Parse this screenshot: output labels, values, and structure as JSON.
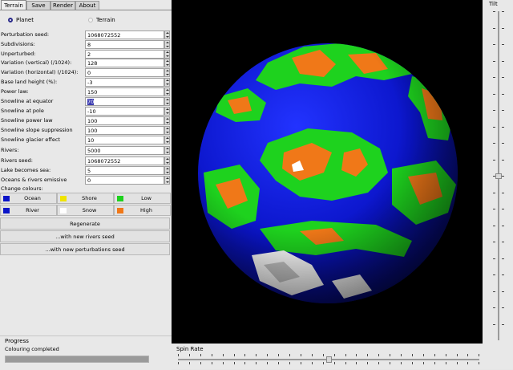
{
  "tabs": [
    "Terrain",
    "Save",
    "Render",
    "About"
  ],
  "active_tab": "Terrain",
  "mode": {
    "options": [
      "Planet",
      "Terrain"
    ],
    "selected": "Planet"
  },
  "parameters": [
    {
      "label": "Perturbation seed:",
      "value": "1068072552"
    },
    {
      "label": "Subdivisions:",
      "value": "8"
    },
    {
      "label": "Unperturbed:",
      "value": "2"
    },
    {
      "label": "Variation (vertical) (/1024):",
      "value": "128"
    },
    {
      "label": "Variation (horizontal) (/1024):",
      "value": "0"
    },
    {
      "label": "Base land height (%):",
      "value": "-3"
    },
    {
      "label": "Power law:",
      "value": "150"
    },
    {
      "label": "Snowline at equator",
      "value": "70"
    },
    {
      "label": "Snowline at pole",
      "value": "-10"
    },
    {
      "label": "Snowline power law",
      "value": "100"
    },
    {
      "label": "Snowline slope suppression",
      "value": "100"
    },
    {
      "label": "Snowline glacier effect",
      "value": "10"
    },
    {
      "label": "Rivers:",
      "value": "5000"
    },
    {
      "label": "Rivers seed:",
      "value": "1068072552"
    },
    {
      "label": "Lake becomes sea:",
      "value": "5"
    },
    {
      "label": "Oceans & rivers emissive",
      "value": "0"
    }
  ],
  "selected_parameter": "Snowline at equator",
  "colours": {
    "title": "Change colours:",
    "items": [
      {
        "label": "Ocean",
        "color": "#0a14c8"
      },
      {
        "label": "Shore",
        "color": "#f0e400"
      },
      {
        "label": "Low",
        "color": "#1ed21e"
      },
      {
        "label": "River",
        "color": "#0a14c8"
      },
      {
        "label": "Snow",
        "color": "#ffffff"
      },
      {
        "label": "High",
        "color": "#f07818"
      }
    ]
  },
  "buttons": {
    "regenerate": "Regenerate",
    "new_rivers_seed": "...with new rivers seed",
    "new_perturbations_seed": "...with new perturbations seed"
  },
  "progress": {
    "title": "Progress",
    "status": "Colouring completed",
    "fraction": 1.0
  },
  "tilt": {
    "label": "Tilt",
    "value": 0.5
  },
  "spin_rate": {
    "label": "Spin Rate",
    "value": 0.5
  },
  "render_colors": {
    "background": "#000000",
    "ocean": "#0a14c8",
    "low": "#1ed21e",
    "high": "#f07818",
    "snow": "#ffffff"
  }
}
